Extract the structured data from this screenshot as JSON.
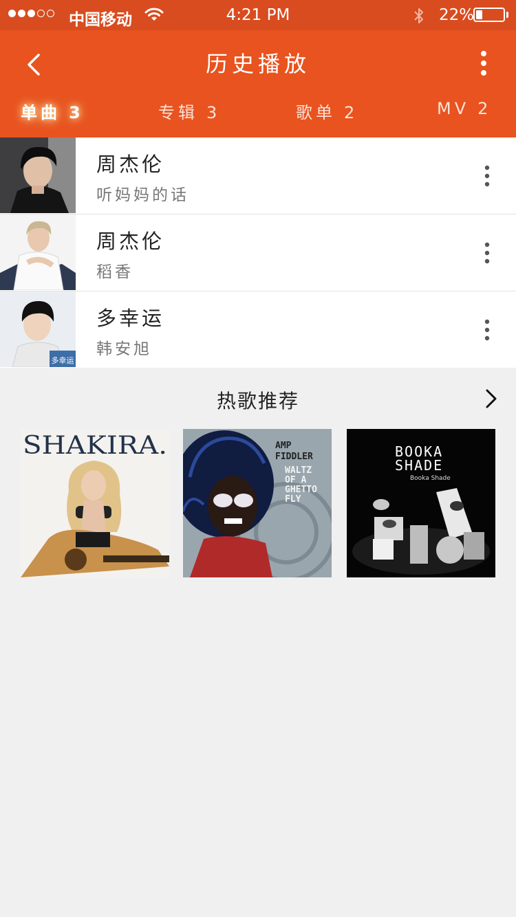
{
  "status_bar": {
    "carrier": "中国移动",
    "time": "4:21 PM",
    "battery": "22%",
    "battery_level": 0.22
  },
  "header": {
    "title": "历史播放",
    "tabs": [
      {
        "label": "单曲",
        "count": "3",
        "active": true
      },
      {
        "label": "专辑",
        "count": "3",
        "active": false
      },
      {
        "label": "歌单",
        "count": "2",
        "active": false
      },
      {
        "label": "MV",
        "count": "2",
        "active": false
      }
    ]
  },
  "history": [
    {
      "title": "周杰伦",
      "subtitle": "听妈妈的话"
    },
    {
      "title": "周杰伦",
      "subtitle": "稻香"
    },
    {
      "title": "多幸运",
      "subtitle": "韩安旭"
    }
  ],
  "recommend": {
    "title": "热歌推荐",
    "albums": [
      {
        "cover_text": "SHAKIRA."
      },
      {
        "cover_text": [
          "AMP",
          "FIDDLER",
          "WALTZ",
          "OF A",
          "GHETTO",
          "FLY"
        ]
      },
      {
        "cover_text": [
          "BOOKA",
          "SHADE",
          "Booka Shade"
        ]
      }
    ],
    "thumb3_text": "多幸运"
  },
  "colors": {
    "status_bar": "#d94c1f",
    "header": "#e8531f",
    "background": "#f0f0f0"
  }
}
